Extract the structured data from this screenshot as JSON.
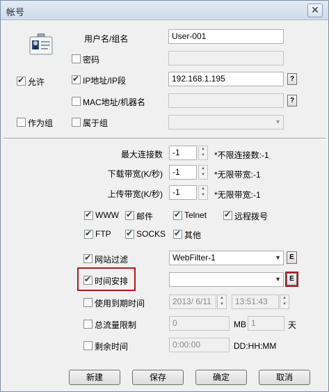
{
  "window": {
    "title": "帐号",
    "close": "✕"
  },
  "user": {
    "name_label": "用户名/组名",
    "name_value": "User-001"
  },
  "password": {
    "label": "密码",
    "checked": false,
    "value": ""
  },
  "allow": {
    "label": "允许",
    "checked": true
  },
  "ip": {
    "label": "IP地址/IP段",
    "checked": true,
    "value": "192.168.1.195",
    "help": "?"
  },
  "mac": {
    "label": "MAC地址/机器名",
    "checked": false,
    "value": "",
    "help": "?"
  },
  "as_group": {
    "label": "作为组",
    "checked": false
  },
  "belongs_group": {
    "label": "属于组",
    "checked": false,
    "value": ""
  },
  "limits": {
    "max_conn": {
      "label": "最大连接数",
      "value": "-1",
      "note": "*不限连接数:-1"
    },
    "download": {
      "label": "下载带宽(K/秒)",
      "value": "-1",
      "note": "*无限带宽:-1"
    },
    "upload": {
      "label": "上传带宽(K/秒)",
      "value": "-1",
      "note": "*无限带宽:-1"
    }
  },
  "services": [
    {
      "label": "WWW",
      "checked": true
    },
    {
      "label": "邮件",
      "checked": true
    },
    {
      "label": "Telnet",
      "checked": true
    },
    {
      "label": "远程拨号",
      "checked": true
    },
    {
      "label": "FTP",
      "checked": true
    },
    {
      "label": "SOCKS",
      "checked": true
    },
    {
      "label": "其他",
      "checked": true
    }
  ],
  "web_filter": {
    "label": "网站过滤",
    "checked": true,
    "value": "WebFilter-1",
    "edit": "E"
  },
  "schedule": {
    "label": "时间安排",
    "checked": true,
    "value": "",
    "edit": "E"
  },
  "expire": {
    "label": "使用到期时间",
    "checked": false,
    "date": "2013/  6/11",
    "time": "13:51:43"
  },
  "traffic": {
    "label": "总流量限制",
    "checked": false,
    "value": "0",
    "unit1": "MB",
    "value2": "1",
    "unit2": "天"
  },
  "remaining": {
    "label": "剩余时间",
    "checked": false,
    "value": "0:00:00",
    "format": "DD:HH:MM"
  },
  "buttons": {
    "new": "新建",
    "save": "保存",
    "ok": "确定",
    "cancel": "取消"
  },
  "colors": {
    "highlight_border": "#b01a1a"
  },
  "icons": {
    "avatar": "user-card-icon"
  }
}
